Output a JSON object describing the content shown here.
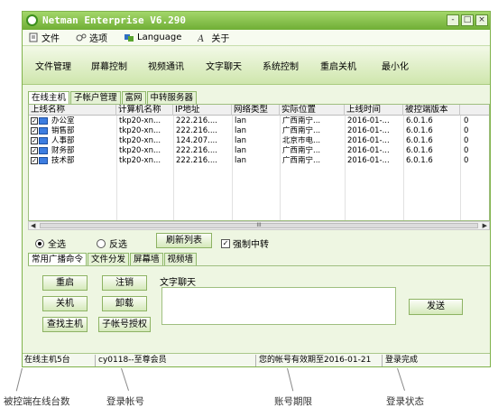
{
  "window": {
    "title": "Netman Enterprise V6.290",
    "controls": [
      "-",
      "□",
      "×"
    ]
  },
  "menu": [
    {
      "icon": "file-icon",
      "label": "文件"
    },
    {
      "icon": "options-icon",
      "label": "选项"
    },
    {
      "icon": "language-icon",
      "label": "Language"
    },
    {
      "icon": "about-icon",
      "label": "关于"
    }
  ],
  "toolbar": [
    "文件管理",
    "屏幕控制",
    "视频通讯",
    "文字聊天",
    "系统控制",
    "重启关机",
    "最小化"
  ],
  "tabs_top": [
    "在线主机",
    "子帐户管理",
    "富网",
    "中转服务器"
  ],
  "table": {
    "columns": [
      "上线名称",
      "计算机名称",
      "IP地址",
      "网络类型",
      "实际位置",
      "上线时间",
      "被控端版本",
      ""
    ],
    "rows": [
      {
        "name": "办公室",
        "computer": "tkp20-xn...",
        "ip": "222.216....",
        "net": "lan",
        "location": "广西南宁...",
        "time": "2016-01-...",
        "version": "6.0.1.6",
        "extra": "0"
      },
      {
        "name": "销售部",
        "computer": "tkp20-xn...",
        "ip": "222.216....",
        "net": "lan",
        "location": "广西南宁...",
        "time": "2016-01-...",
        "version": "6.0.1.6",
        "extra": "0"
      },
      {
        "name": "人事部",
        "computer": "tkp20-xn...",
        "ip": "124.207....",
        "net": "lan",
        "location": "北京市电...",
        "time": "2016-01-...",
        "version": "6.0.1.6",
        "extra": "0"
      },
      {
        "name": "财务部",
        "computer": "tkp20-xn...",
        "ip": "222.216....",
        "net": "lan",
        "location": "广西南宁...",
        "time": "2016-01-...",
        "version": "6.0.1.6",
        "extra": "0"
      },
      {
        "name": "技术部",
        "computer": "tkp20-xn...",
        "ip": "222.216....",
        "net": "lan",
        "location": "广西南宁...",
        "time": "2016-01-...",
        "version": "6.0.1.6",
        "extra": "0"
      }
    ],
    "scroll_mark": "III"
  },
  "selection": {
    "select_all": "全选",
    "invert": "反选",
    "refresh": "刷新列表",
    "force_relay": "强制中转"
  },
  "tabs_bottom": [
    "常用广播命令",
    "文件分发",
    "屏幕墙",
    "视频墙"
  ],
  "commands": {
    "restart": "重启",
    "logout": "注销",
    "shutdown": "关机",
    "uninstall": "卸载",
    "find_host": "查找主机",
    "sub_auth": "子帐号授权"
  },
  "chat": {
    "label": "文字聊天",
    "send": "发送"
  },
  "status": {
    "online": "在线主机5台",
    "account": "cy0118--至尊会员",
    "expiry": "您的帐号有效期至2016-01-21",
    "login": "登录完成"
  },
  "callouts": {
    "online": "被控端在线台数",
    "account": "登录帐号",
    "expiry": "账号期限",
    "login": "登录状态"
  }
}
